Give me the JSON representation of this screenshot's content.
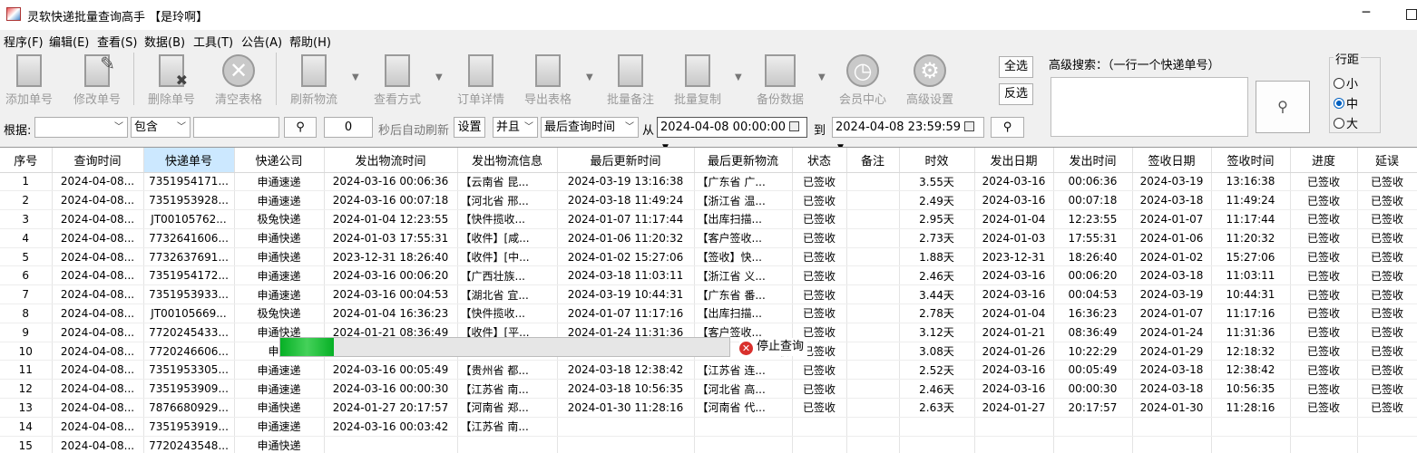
{
  "window": {
    "title": "灵软快递批量查询高手 【是玲啊】"
  },
  "menu": [
    "程序(F)",
    "编辑(E)",
    "查看(S)",
    "数据(B)",
    "工具(T)",
    "公告(A)",
    "帮助(H)"
  ],
  "toolbar": {
    "add": "添加单号",
    "edit": "修改单号",
    "delete": "删除单号",
    "clear": "清空表格",
    "refresh": "刷新物流",
    "view_mode": "查看方式",
    "order_detail": "订单详情",
    "export": "导出表格",
    "batch_note": "批量备注",
    "batch_copy": "批量复制",
    "backup": "备份数据",
    "member": "会员中心",
    "advanced": "高级设置",
    "select_all": "全选",
    "invert": "反选"
  },
  "advanced_search": {
    "label": "高级搜索：（一行一个快递单号）",
    "value": ""
  },
  "row_spacing": {
    "legend": "行距",
    "options": [
      "小",
      "中",
      "大"
    ],
    "selected": "中"
  },
  "filter": {
    "label": "根据:",
    "field_value": "",
    "match": "包含",
    "keyword": "",
    "refresh_seconds": "0",
    "auto_refresh_label": "秒后自动刷新",
    "settings": "设置",
    "logic": "并且",
    "time_field": "最后查询时间",
    "from_label": "从",
    "from": "2024-04-08 00:00:00",
    "to_label": "到",
    "to": "2024-04-08 23:59:59"
  },
  "table": {
    "headers": [
      "序号",
      "查询时间",
      "快递单号",
      "快递公司",
      "发出物流时间",
      "发出物流信息",
      "最后更新时间",
      "最后更新物流",
      "状态",
      "备注",
      "时效",
      "发出日期",
      "发出时间",
      "签收日期",
      "签收时间",
      "进度",
      "延误"
    ],
    "rows": [
      [
        "1",
        "2024-04-08...",
        "7351954171...",
        "申通速递",
        "2024-03-16 00:06:36",
        "【云南省 昆...",
        "2024-03-19 13:16:38",
        "【广东省 广...",
        "已签收",
        "",
        "3.55天",
        "2024-03-16",
        "00:06:36",
        "2024-03-19",
        "13:16:38",
        "已签收",
        "已签收"
      ],
      [
        "2",
        "2024-04-08...",
        "7351953928...",
        "申通速递",
        "2024-03-16 00:07:18",
        "【河北省 邢...",
        "2024-03-18 11:49:24",
        "【浙江省 温...",
        "已签收",
        "",
        "2.49天",
        "2024-03-16",
        "00:07:18",
        "2024-03-18",
        "11:49:24",
        "已签收",
        "已签收"
      ],
      [
        "3",
        "2024-04-08...",
        "JT00105762...",
        "极兔快递",
        "2024-01-04 12:23:55",
        "【快件揽收...",
        "2024-01-07 11:17:44",
        "【出库扫描...",
        "已签收",
        "",
        "2.95天",
        "2024-01-04",
        "12:23:55",
        "2024-01-07",
        "11:17:44",
        "已签收",
        "已签收"
      ],
      [
        "4",
        "2024-04-08...",
        "7732641606...",
        "申通快递",
        "2024-01-03 17:55:31",
        "【收件】[咸...",
        "2024-01-06 11:20:32",
        "【客户签收...",
        "已签收",
        "",
        "2.73天",
        "2024-01-03",
        "17:55:31",
        "2024-01-06",
        "11:20:32",
        "已签收",
        "已签收"
      ],
      [
        "5",
        "2024-04-08...",
        "7732637691...",
        "申通快递",
        "2023-12-31 18:26:40",
        "【收件】[中...",
        "2024-01-02 15:27:06",
        "【签收】快...",
        "已签收",
        "",
        "1.88天",
        "2023-12-31",
        "18:26:40",
        "2024-01-02",
        "15:27:06",
        "已签收",
        "已签收"
      ],
      [
        "6",
        "2024-04-08...",
        "7351954172...",
        "申通速递",
        "2024-03-16 00:06:20",
        "【广西壮族...",
        "2024-03-18 11:03:11",
        "【浙江省 义...",
        "已签收",
        "",
        "2.46天",
        "2024-03-16",
        "00:06:20",
        "2024-03-18",
        "11:03:11",
        "已签收",
        "已签收"
      ],
      [
        "7",
        "2024-04-08...",
        "7351953933...",
        "申通速递",
        "2024-03-16 00:04:53",
        "【湖北省 宜...",
        "2024-03-19 10:44:31",
        "【广东省 番...",
        "已签收",
        "",
        "3.44天",
        "2024-03-16",
        "00:04:53",
        "2024-03-19",
        "10:44:31",
        "已签收",
        "已签收"
      ],
      [
        "8",
        "2024-04-08...",
        "JT00105669...",
        "极兔快递",
        "2024-01-04 16:36:23",
        "【快件揽收...",
        "2024-01-07 11:17:16",
        "【出库扫描...",
        "已签收",
        "",
        "2.78天",
        "2024-01-04",
        "16:36:23",
        "2024-01-07",
        "11:17:16",
        "已签收",
        "已签收"
      ],
      [
        "9",
        "2024-04-08...",
        "7720245433...",
        "申通快递",
        "2024-01-21 08:36:49",
        "【收件】[平...",
        "2024-01-24 11:31:36",
        "【客户签收...",
        "已签收",
        "",
        "3.12天",
        "2024-01-21",
        "08:36:49",
        "2024-01-24",
        "11:31:36",
        "已签收",
        "已签收"
      ],
      [
        "10",
        "2024-04-08...",
        "7720246606...",
        "申通",
        "",
        "",
        "",
        "收",
        "已签收",
        "",
        "3.08天",
        "2024-01-26",
        "10:22:29",
        "2024-01-29",
        "12:18:32",
        "已签收",
        "已签收"
      ],
      [
        "11",
        "2024-04-08...",
        "7351953305...",
        "申通速递",
        "2024-03-16 00:05:49",
        "【贵州省 都...",
        "2024-03-18 12:38:42",
        "【江苏省 连...",
        "已签收",
        "",
        "2.52天",
        "2024-03-16",
        "00:05:49",
        "2024-03-18",
        "12:38:42",
        "已签收",
        "已签收"
      ],
      [
        "12",
        "2024-04-08...",
        "7351953909...",
        "申通速递",
        "2024-03-16 00:00:30",
        "【江苏省 南...",
        "2024-03-18 10:56:35",
        "【河北省 高...",
        "已签收",
        "",
        "2.46天",
        "2024-03-16",
        "00:00:30",
        "2024-03-18",
        "10:56:35",
        "已签收",
        "已签收"
      ],
      [
        "13",
        "2024-04-08...",
        "7876680929...",
        "申通快递",
        "2024-01-27 20:17:57",
        "【河南省 郑...",
        "2024-01-30 11:28:16",
        "【河南省 代...",
        "已签收",
        "",
        "2.63天",
        "2024-01-27",
        "20:17:57",
        "2024-01-30",
        "11:28:16",
        "已签收",
        "已签收"
      ],
      [
        "14",
        "2024-04-08...",
        "7351953919...",
        "申通速递",
        "2024-03-16 00:03:42",
        "【江苏省 南...",
        "",
        "",
        "",
        "",
        "",
        "",
        "",
        "",
        "",
        "",
        ""
      ],
      [
        "15",
        "2024-04-08...",
        "7720243548...",
        "申通快递",
        "",
        "",
        "",
        "",
        "",
        "",
        "",
        "",
        "",
        "",
        "",
        "",
        ""
      ]
    ]
  },
  "progress": {
    "fraction": 0.12,
    "stop_label": "停止查询"
  },
  "colors": {
    "progress": "#06b025",
    "header_selected": "#cce8ff",
    "stop": "#d9302c"
  }
}
